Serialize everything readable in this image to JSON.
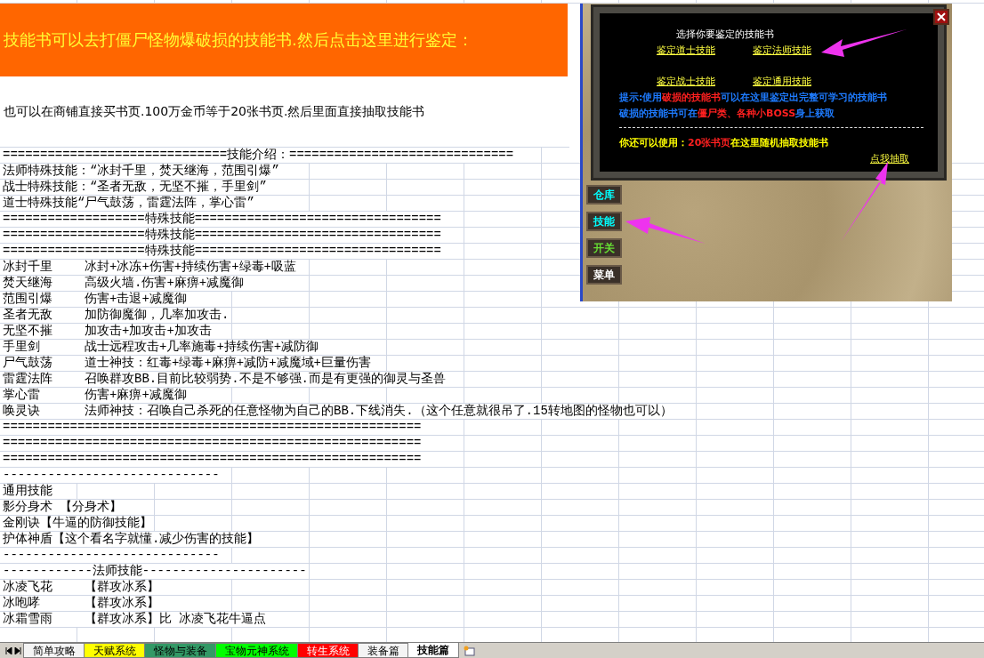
{
  "banner": {
    "text": "技能书可以去打僵尸怪物爆破损的技能书.然后点击这里进行鉴定："
  },
  "note": "也可以在商铺直接买书页.100万金币等于20张书页.然后里面直接抽取技能书",
  "sheet_rows": [
    {
      "kind": "line",
      "text": "==============================技能介绍：=============================="
    },
    {
      "kind": "line",
      "text": "法师特殊技能：“冰封千里，焚天继海，范围引爆”"
    },
    {
      "kind": "line",
      "text": "战士特殊技能：“圣者无敌，无坚不摧，手里剑”"
    },
    {
      "kind": "line",
      "text": "道士特殊技能“尸气鼓荡，雷霆法阵，掌心雷”"
    },
    {
      "kind": "line",
      "text": "===================特殊技能================================="
    },
    {
      "kind": "line",
      "text": "===================特殊技能================================="
    },
    {
      "kind": "line",
      "text": "===================特殊技能================================="
    },
    {
      "kind": "pair",
      "name": "冰封千里",
      "detail": "冰封+冰冻+伤害+持续伤害+绿毒+吸蓝"
    },
    {
      "kind": "pair",
      "name": "焚天继海",
      "detail": "高级火墙.伤害+麻痹+减魔御"
    },
    {
      "kind": "pair",
      "name": "范围引爆",
      "detail": "伤害+击退+减魔御"
    },
    {
      "kind": "pair",
      "name": "圣者无敌",
      "detail": "加防御魔御，几率加攻击."
    },
    {
      "kind": "pair",
      "name": "无坚不摧",
      "detail": "加攻击+加攻击+加攻击"
    },
    {
      "kind": "pair",
      "name": "手里剑",
      "detail": "战士远程攻击+几率施毒+持续伤害+减防御"
    },
    {
      "kind": "pair",
      "name": "尸气鼓荡",
      "detail": "道士神技：红毒+绿毒+麻痹+减防+减魔域+巨量伤害"
    },
    {
      "kind": "pair",
      "name": "雷霆法阵",
      "detail": "召唤群攻BB.目前比较弱势.不是不够强.而是有更强的御灵与圣兽"
    },
    {
      "kind": "pair",
      "name": "掌心雷",
      "detail": "伤害+麻痹+减魔御"
    },
    {
      "kind": "pair",
      "name": "唤灵诀",
      "detail": "法师神技：召唤自己杀死的任意怪物为自己的BB.下线消失.（这个任意就很吊了.15转地图的怪物也可以）"
    },
    {
      "kind": "line",
      "text": "========================================================"
    },
    {
      "kind": "line",
      "text": "========================================================"
    },
    {
      "kind": "line",
      "text": "========================================================"
    },
    {
      "kind": "line",
      "text": "-----------------------------"
    },
    {
      "kind": "line",
      "text": "通用技能"
    },
    {
      "kind": "line",
      "text": "影分身术 【分身术】"
    },
    {
      "kind": "line",
      "text": "金刚诀【牛逼的防御技能】"
    },
    {
      "kind": "line",
      "text": "护体神盾【这个看名字就懂.减少伤害的技能】"
    },
    {
      "kind": "line",
      "text": "-----------------------------"
    },
    {
      "kind": "line",
      "text": "------------法师技能----------------------"
    },
    {
      "kind": "pair",
      "name": "冰凌飞花",
      "detail": "【群攻冰系】"
    },
    {
      "kind": "pair",
      "name": "冰咆哮",
      "detail": "【群攻冰系】"
    },
    {
      "kind": "pair",
      "name": "冰霜雪雨",
      "detail": "【群攻冰系】比 冰凌飞花牛逼点"
    }
  ],
  "game_panel": {
    "dialog": {
      "title": "选择你要鉴定的技能书",
      "links": [
        "鉴定道士技能",
        "鉴定法师技能",
        "鉴定战士技能",
        "鉴定通用技能"
      ],
      "hint_lines": [
        [
          {
            "text": "提示:使用",
            "color": "#1e7bff"
          },
          {
            "text": "破损的技能书",
            "color": "#ff2020"
          },
          {
            "text": "可以在这里鉴定出完整可学习的技能书",
            "color": "#1e7bff"
          }
        ],
        [
          {
            "text": "破损的技能书可在",
            "color": "#1e7bff"
          },
          {
            "text": "僵尸类、各种小BOSS",
            "color": "#ff2020"
          },
          {
            "text": "身上获取",
            "color": "#1e7bff"
          }
        ]
      ],
      "usage_line": [
        {
          "text": "你还可以使用：",
          "color": "#ffff00"
        },
        {
          "text": "20张书页",
          "color": "#ff2020"
        },
        {
          "text": "在这里随机抽取技能书",
          "color": "#ffff00"
        }
      ],
      "draw_link": "点我抽取"
    },
    "side_buttons": [
      {
        "label": "仓库",
        "color": "#00ffff"
      },
      {
        "label": "技能",
        "color": "#00ffff"
      },
      {
        "label": "开关",
        "color": "#66dd33"
      },
      {
        "label": "菜单",
        "color": "#ffffff"
      }
    ]
  },
  "sheet_tabs": [
    {
      "label": "简单攻略",
      "color": "#f4f4f4",
      "selected": false
    },
    {
      "label": "天赋系统",
      "color": "#ffff00",
      "selected": false
    },
    {
      "label": "怪物与装备",
      "color": "#339966",
      "selected": false
    },
    {
      "label": "宝物元神系统",
      "color": "#00ff00",
      "selected": false
    },
    {
      "label": "转生系统",
      "color": "#ff0000",
      "selected": false
    },
    {
      "label": "装备篇",
      "color": "#f4f4f4",
      "selected": false
    },
    {
      "label": "技能篇",
      "color": "#ffffff",
      "selected": true
    }
  ]
}
